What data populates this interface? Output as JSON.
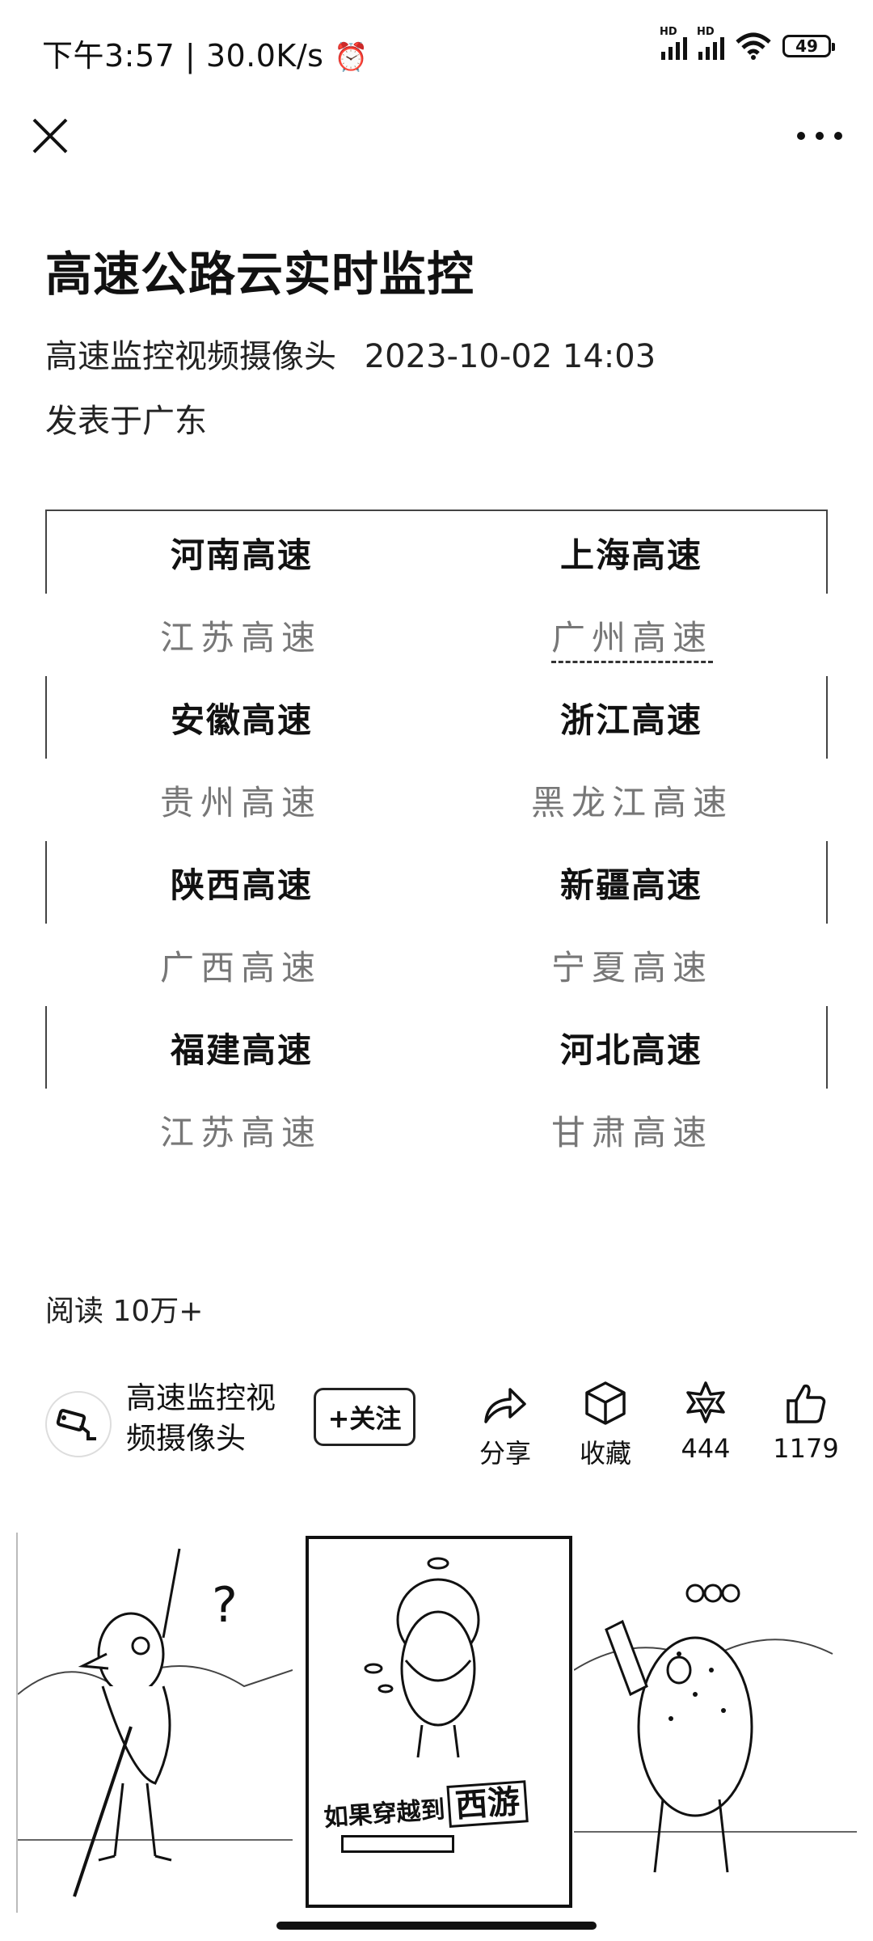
{
  "status_bar": {
    "time": "下午3:57",
    "speed": "30.0K/s",
    "signal_label": "HD",
    "battery": "49"
  },
  "article": {
    "title": "高速公路云实时监控",
    "author": "高速监控视频摄像头",
    "date": "2023-10-02 14:03",
    "location": "发表于广东",
    "reads": "阅读 10万+"
  },
  "grid": {
    "rows": [
      [
        "河南高速",
        "上海高速"
      ],
      [
        "江苏高速",
        "广州高速"
      ],
      [
        "安徽高速",
        "浙江高速"
      ],
      [
        "贵州高速",
        "黑龙江高速"
      ],
      [
        "陕西高速",
        "新疆高速"
      ],
      [
        "广西高速",
        "宁夏高速"
      ],
      [
        "福建高速",
        "河北高速"
      ],
      [
        "江苏高速",
        "甘肃高速"
      ]
    ]
  },
  "author_bar": {
    "name": "高速监控视频摄像头",
    "follow": "+关注",
    "share": "分享",
    "favorite": "收藏",
    "wow_count": "444",
    "like_count": "1179"
  },
  "ad": {
    "caption_prefix": "如果穿越到",
    "caption_big": "西游"
  },
  "icons": [
    "close-icon",
    "more-icon",
    "share-icon",
    "favorite-icon",
    "wow-icon",
    "like-icon",
    "camera-icon"
  ]
}
